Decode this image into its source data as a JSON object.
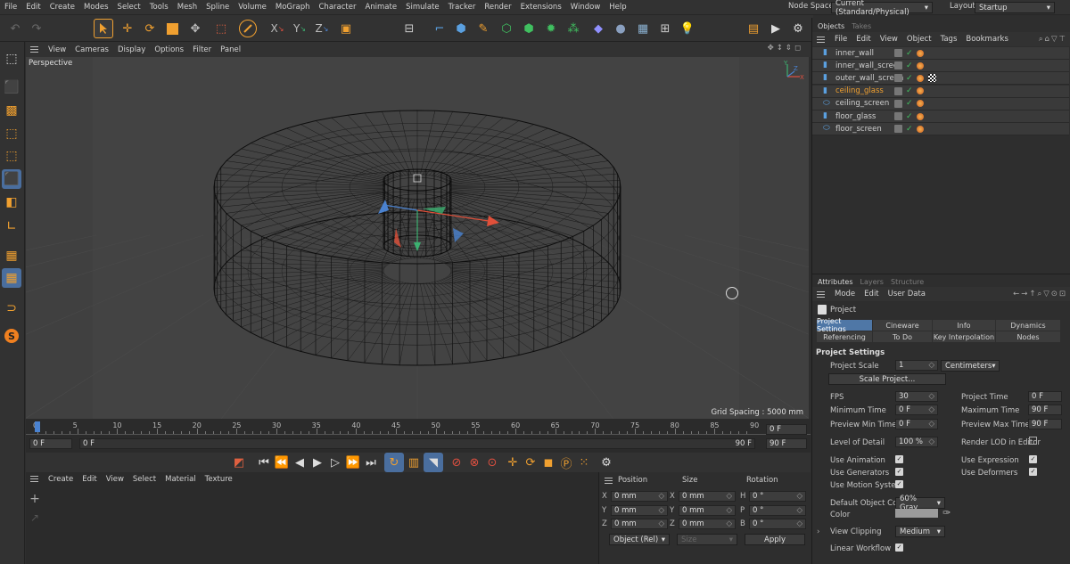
{
  "menubar": {
    "items": [
      "File",
      "Edit",
      "Create",
      "Modes",
      "Select",
      "Tools",
      "Mesh",
      "Spline",
      "Volume",
      "MoGraph",
      "Character",
      "Animate",
      "Simulate",
      "Tracker",
      "Render",
      "Extensions",
      "Window",
      "Help"
    ],
    "node_space_label": "Node Space:",
    "node_space_value": "Current (Standard/Physical)",
    "layout_label": "Layout:",
    "layout_value": "Startup"
  },
  "viewport": {
    "menu": [
      "View",
      "Cameras",
      "Display",
      "Options",
      "Filter",
      "Panel"
    ],
    "name": "Perspective",
    "grid_spacing": "Grid Spacing : 5000 mm"
  },
  "timeline": {
    "ticks": [
      "0",
      "5",
      "10",
      "15",
      "20",
      "25",
      "30",
      "35",
      "40",
      "45",
      "50",
      "55",
      "60",
      "65",
      "70",
      "75",
      "80",
      "85",
      "90"
    ],
    "start": "0 F",
    "current": "0 F",
    "end_marker": "90 F",
    "end_right": "90 F",
    "current_right": "0 F"
  },
  "objects_panel": {
    "tabs": [
      "Objects",
      "Takes"
    ],
    "menu": [
      "File",
      "Edit",
      "View",
      "Object",
      "Tags",
      "Bookmarks"
    ],
    "objects": [
      {
        "name": "inner_wall",
        "selected": false
      },
      {
        "name": "inner_wall_screen",
        "selected": false
      },
      {
        "name": "outer_wall_screen",
        "selected": false
      },
      {
        "name": "ceiling_glass",
        "selected": true
      },
      {
        "name": "ceiling_screen",
        "selected": false
      },
      {
        "name": "floor_glass",
        "selected": false
      },
      {
        "name": "floor_screen",
        "selected": false
      }
    ]
  },
  "attributes": {
    "tabs": [
      "Attributes",
      "Layers",
      "Structure"
    ],
    "menu": [
      "Mode",
      "Edit",
      "User Data"
    ],
    "header": "Project",
    "ptabs_row1": [
      "Project Settings",
      "Cineware",
      "Info",
      "Dynamics"
    ],
    "ptabs_row2": [
      "Referencing",
      "To Do",
      "Key Interpolation",
      "Nodes"
    ],
    "section": "Project Settings",
    "project_scale_label": "Project Scale",
    "project_scale_value": "1",
    "project_scale_unit": "Centimeters",
    "scale_project_button": "Scale Project...",
    "fps_label": "FPS",
    "fps": "30",
    "project_time_label": "Project Time",
    "project_time": "0 F",
    "min_time_label": "Minimum Time",
    "min_time": "0 F",
    "max_time_label": "Maximum Time",
    "max_time": "90 F",
    "preview_min_label": "Preview Min Time",
    "preview_min": "0 F",
    "preview_max_label": "Preview Max Time",
    "preview_max": "90 F",
    "lod_label": "Level of Detail",
    "lod": "100 %",
    "render_lod_label": "Render LOD in Editor",
    "use_animation": "Use Animation",
    "use_expression": "Use Expression",
    "use_generators": "Use Generators",
    "use_deformers": "Use Deformers",
    "use_motion": "Use Motion System",
    "default_color_label": "Default Object Color",
    "default_color": "60% Gray",
    "color_label": "Color",
    "view_clipping_label": "View Clipping",
    "view_clipping": "Medium",
    "linear_workflow": "Linear Workflow"
  },
  "material_manager": {
    "menu": [
      "Create",
      "Edit",
      "View",
      "Select",
      "Material",
      "Texture"
    ]
  },
  "coordinates": {
    "headers": [
      "Position",
      "Size",
      "Rotation"
    ],
    "rows": [
      {
        "a": "X",
        "pos": "0 mm",
        "b": "X",
        "size": "0 mm",
        "c": "H",
        "rot": "0 °"
      },
      {
        "a": "Y",
        "pos": "0 mm",
        "b": "Y",
        "size": "0 mm",
        "c": "P",
        "rot": "0 °"
      },
      {
        "a": "Z",
        "pos": "0 mm",
        "b": "Z",
        "size": "0 mm",
        "c": "B",
        "rot": "0 °"
      }
    ],
    "mode": "Object (Rel)",
    "size_mode": "Size",
    "apply": "Apply"
  },
  "colors": {
    "accent": "#4f77a6",
    "selected_object": "#f0a030",
    "axis_x": "#e0503a",
    "axis_y": "#3cb070",
    "axis_z": "#4a82d0"
  }
}
